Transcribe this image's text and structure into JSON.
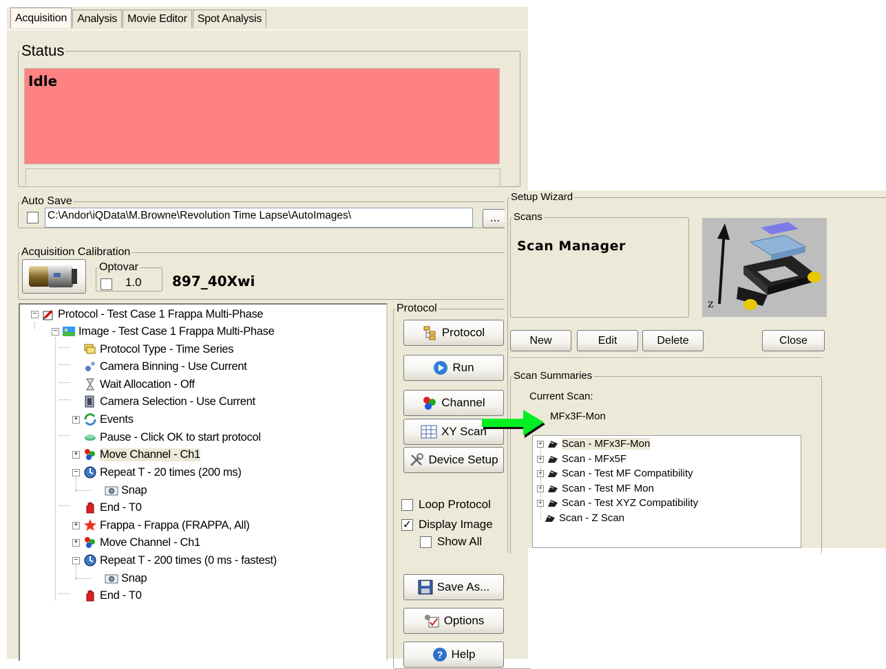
{
  "main": {
    "tabs": [
      "Acquisition",
      "Analysis",
      "Movie Editor",
      "Spot Analysis"
    ],
    "active_tab": "Acquisition",
    "status": {
      "legend": "Status",
      "text": "Idle",
      "bg_color": "#ff8282"
    },
    "auto_save": {
      "legend": "Auto Save",
      "checked": false,
      "path": "C:\\Andor\\iQData\\M.Browne\\Revolution Time Lapse\\AutoImages\\",
      "browse_label": "..."
    },
    "calibration": {
      "legend": "Acquisition Calibration",
      "optovar_legend": "Optovar",
      "optovar_value": "1.0",
      "objective": "897_40Xwi"
    },
    "tree": [
      {
        "label": "Protocol - Test Case 1 Frappa Multi-Phase",
        "icon": "protocol-icon",
        "expander": "minus"
      },
      {
        "label": "Image - Test Case 1 Frappa Multi-Phase",
        "icon": "image-icon",
        "expander": "minus"
      },
      {
        "label": "Protocol Type - Time Series",
        "icon": "folders-icon",
        "expander": ""
      },
      {
        "label": "Camera Binning - Use Current",
        "icon": "gears-icon",
        "expander": ""
      },
      {
        "label": "Wait Allocation - Off",
        "icon": "hourglass-icon",
        "expander": ""
      },
      {
        "label": "Camera Selection - Use Current",
        "icon": "camera-select-icon",
        "expander": ""
      },
      {
        "label": "Events",
        "icon": "events-icon",
        "expander": "plus"
      },
      {
        "label": "Pause - Click OK to start protocol",
        "icon": "pause-icon",
        "expander": ""
      },
      {
        "label": "Move Channel - Ch1",
        "icon": "channel-icon",
        "expander": "plus",
        "selected": true
      },
      {
        "label": "Repeat T - 20 times (200 ms)",
        "icon": "clock-icon",
        "expander": "minus"
      },
      {
        "label": "Snap",
        "icon": "snap-icon",
        "expander": ""
      },
      {
        "label": "End - T0",
        "icon": "hand-icon",
        "expander": ""
      },
      {
        "label": "Frappa - Frappa (FRAPPA, All)",
        "icon": "star-icon",
        "expander": "plus"
      },
      {
        "label": "Move Channel - Ch1",
        "icon": "channel-icon",
        "expander": "plus"
      },
      {
        "label": "Repeat T - 200 times (0 ms - fastest)",
        "icon": "clock-icon",
        "expander": "minus"
      },
      {
        "label": "Snap",
        "icon": "snap-icon",
        "expander": ""
      },
      {
        "label": "End - T0",
        "icon": "hand-icon",
        "expander": ""
      }
    ],
    "protocol_panel": {
      "legend": "Protocol",
      "buttons": {
        "protocol": "Protocol",
        "run": "Run",
        "channel": "Channel",
        "xy_scan": "XY Scan",
        "device_setup": "Device Setup",
        "save_as": "Save As...",
        "options": "Options",
        "help": "Help"
      },
      "loop_protocol": {
        "label": "Loop Protocol",
        "checked": false
      },
      "display_image": {
        "label": "Display Image",
        "checked": true
      },
      "show_all": {
        "label": "Show All",
        "checked": false
      }
    }
  },
  "wizard": {
    "legend": "Setup Wizard",
    "scans_legend": "Scans",
    "title": "Scan Manager",
    "buttons": {
      "new": "New",
      "edit": "Edit",
      "delete": "Delete",
      "close": "Close"
    },
    "summaries_legend": "Scan Summaries",
    "current_scan_label": "Current Scan:",
    "current_scan_value": "MFx3F-Mon",
    "arrow_color": "#00ee22",
    "scan_list": [
      {
        "label": "Scan - MFx3F-Mon",
        "expander": "plus",
        "selected": true
      },
      {
        "label": "Scan - MFx5F",
        "expander": "plus"
      },
      {
        "label": "Scan - Test MF Compatibility",
        "expander": "plus"
      },
      {
        "label": "Scan - Test MF Mon",
        "expander": "plus"
      },
      {
        "label": "Scan - Test XYZ Compatibility",
        "expander": "plus"
      },
      {
        "label": "Scan - Z Scan",
        "expander": ""
      }
    ]
  }
}
